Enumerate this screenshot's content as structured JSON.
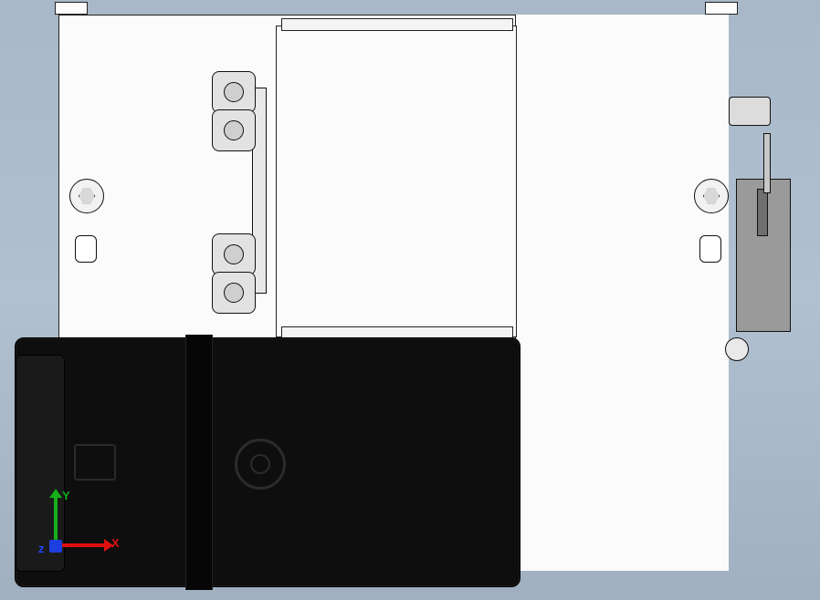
{
  "triad": {
    "x_label": "X",
    "y_label": "Y",
    "z_label": "z"
  },
  "view": {
    "background": "gradient-gray-blue",
    "model_orientation": "Front"
  },
  "parts": {
    "main_plate": "main-plate",
    "raised_panel": "raised-panel",
    "motor_housing": "motor-housing",
    "side_clamp": "side-clamp",
    "mount_boss_count": 4
  }
}
